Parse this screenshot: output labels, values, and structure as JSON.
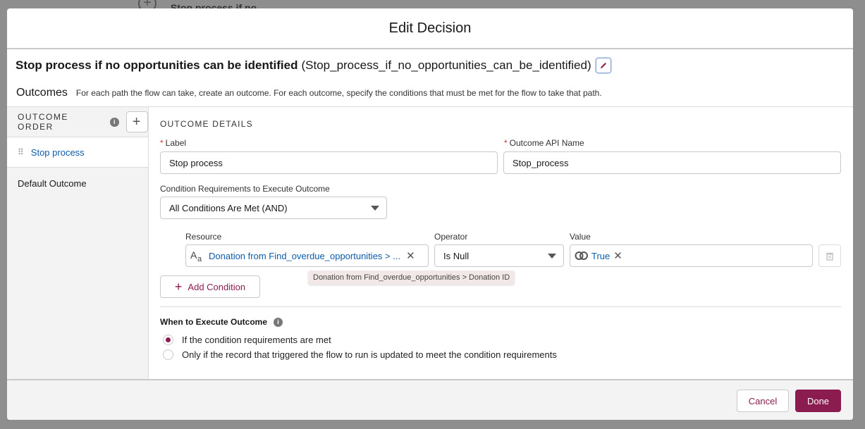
{
  "background": {
    "node_text": "Stop process if no"
  },
  "modal": {
    "title": "Edit Decision",
    "element_label": "Stop process if no opportunities can be identified",
    "element_api_name": "(Stop_process_if_no_opportunities_can_be_identified)",
    "outcomes_title": "Outcomes",
    "outcomes_description": "For each path the flow can take, create an outcome. For each outcome, specify the conditions that must be met for the flow to take that path."
  },
  "sidebar": {
    "header": "OUTCOME ORDER",
    "items": [
      {
        "label": "Stop process",
        "active": true
      },
      {
        "label": "Default Outcome",
        "active": false
      }
    ]
  },
  "details": {
    "section_title": "OUTCOME DETAILS",
    "label_field": {
      "label": "Label",
      "value": "Stop process"
    },
    "api_field": {
      "label": "Outcome API Name",
      "value": "Stop_process"
    },
    "condition_req": {
      "label": "Condition Requirements to Execute Outcome",
      "value": "All Conditions Are Met (AND)"
    },
    "condition": {
      "resource_label": "Resource",
      "resource_value": "Donation from Find_overdue_opportunities > ...",
      "operator_label": "Operator",
      "operator_value": "Is Null",
      "value_label": "Value",
      "value_value": "True"
    },
    "tooltip": "Donation from Find_overdue_opportunities > Donation ID",
    "add_condition": "Add Condition",
    "when_title": "When to Execute Outcome",
    "options": [
      {
        "label": "If the condition requirements are met",
        "selected": true
      },
      {
        "label": "Only if the record that triggered the flow to run is updated to meet the condition requirements",
        "selected": false
      }
    ]
  },
  "footer": {
    "cancel": "Cancel",
    "done": "Done"
  },
  "colors": {
    "brand": "#8a1c4f",
    "link": "#0b5cab"
  }
}
